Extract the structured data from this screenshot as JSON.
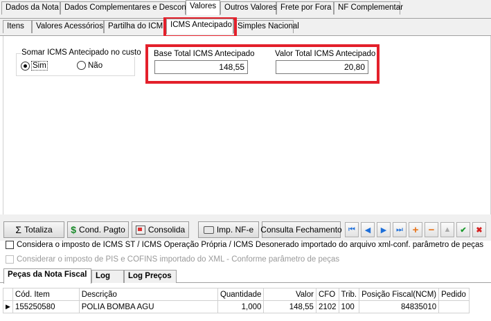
{
  "main_tabs": [
    "Dados da Nota",
    "Dados Complementares e Desconto",
    "Valores",
    "Outros Valores",
    "Frete por Fora",
    "NF Complementar"
  ],
  "sub_tabs": [
    "Itens",
    "Valores Acessórios",
    "Partilha do ICMS",
    "ICMS Antecipado",
    "Simples Nacional"
  ],
  "somar": {
    "label": "Somar ICMS Antecipado no custo",
    "option_sim": "Sim",
    "option_nao": "Não",
    "selected": "Sim"
  },
  "base_total": {
    "label": "Base Total ICMS Antecipado",
    "value": "148,55"
  },
  "valor_total": {
    "label": "Valor Total ICMS Antecipado",
    "value": "20,80"
  },
  "toolbar": {
    "totaliza": "Totaliza",
    "cond_pagto": "Cond. Pagto",
    "consolida": "Consolida",
    "imp_nfe": "Imp. NF-e",
    "consulta_fechamento": "Consulta Fechamento"
  },
  "checkboxes": {
    "icms_st": "Considera o imposto de ICMS ST / ICMS Operação Própria / ICMS Desonerado importado do arquivo xml-conf. parâmetro de peças",
    "pis_cofins": "Considerar o imposto de PIS e COFINS importado do XML - Conforme parâmetro de peças"
  },
  "bottom_tabs": [
    "Peças da Nota Fiscal",
    "Log",
    "Log Preços"
  ],
  "grid": {
    "headers": [
      "Cód. Item",
      "Descrição",
      "Quantidade",
      "Valor",
      "CFO",
      "Trib.",
      "Posição Fiscal(NCM)",
      "Pedido"
    ],
    "rows": [
      [
        "155250580",
        "POLIA BOMBA AGU",
        "1,000",
        "148,55",
        "2102",
        "100",
        "84835010",
        ""
      ]
    ]
  },
  "colors": {
    "highlight": "#e3202b",
    "nav_blue": "#1e6fd9",
    "add_orange": "#e8741a",
    "ok_green": "#1a9a2c",
    "cancel_red": "#d42121"
  }
}
